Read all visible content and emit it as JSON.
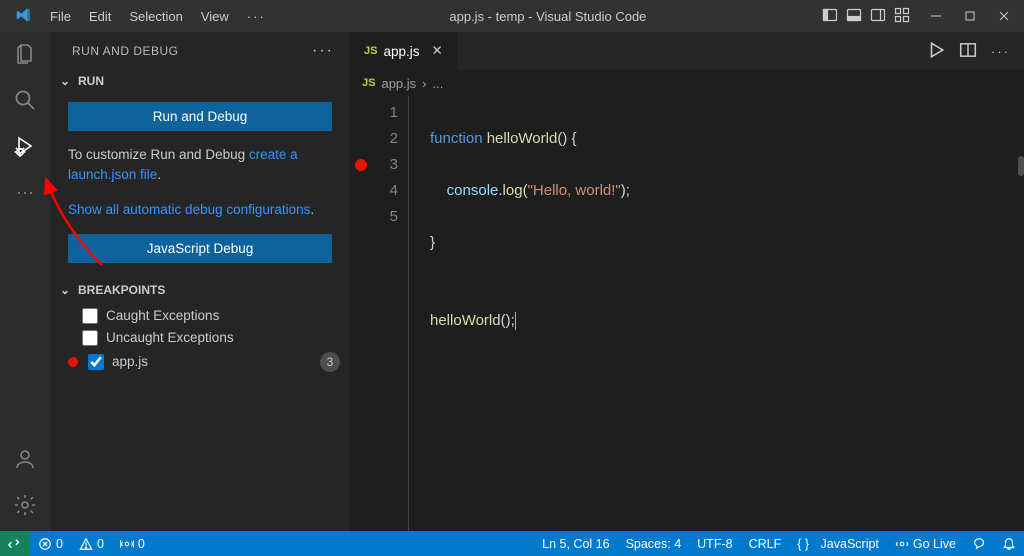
{
  "titlebar": {
    "menus": [
      "File",
      "Edit",
      "Selection",
      "View"
    ],
    "overflow": "···",
    "title": "app.js - temp - Visual Studio Code"
  },
  "sidebar": {
    "header": "RUN AND DEBUG",
    "sections": {
      "run": {
        "label": "RUN",
        "button_primary": "Run and Debug",
        "customize_prefix": "To customize Run and Debug ",
        "customize_link": "create a launch.json file",
        "customize_suffix": ".",
        "showall_link": "Show all automatic debug configurations",
        "showall_suffix": ".",
        "button_secondary": "JavaScript Debug"
      },
      "breakpoints": {
        "label": "BREAKPOINTS",
        "items": [
          {
            "label": "Caught Exceptions",
            "checked": false
          },
          {
            "label": "Uncaught Exceptions",
            "checked": false
          }
        ],
        "file": {
          "label": "app.js",
          "checked": true,
          "count": "3"
        }
      }
    }
  },
  "editor": {
    "tab": {
      "icon": "JS",
      "label": "app.js"
    },
    "breadcrumb": {
      "icon": "JS",
      "file": "app.js",
      "sep": "›",
      "rest": "..."
    },
    "code": {
      "lines": [
        "1",
        "2",
        "3",
        "4",
        "5"
      ],
      "breakpoint_line": 3,
      "l1_kw": "function",
      "l1_fn": "helloWorld",
      "l1_rest": "() {",
      "l2_obj": "console",
      "l2_dot": ".",
      "l2_fn": "log",
      "l2_open": "(",
      "l2_str": "\"Hello, world!\"",
      "l2_close": ");",
      "l3": "}",
      "l4": "",
      "l5_fn": "helloWorld",
      "l5_rest": "();"
    }
  },
  "statusbar": {
    "errors": "0",
    "warnings": "0",
    "ports": "0",
    "cursor": "Ln 5, Col 16",
    "spaces": "Spaces: 4",
    "encoding": "UTF-8",
    "eol": "CRLF",
    "language": "JavaScript",
    "golive": "Go Live"
  },
  "icons": {
    "activity": [
      "explorer",
      "search",
      "debug",
      "ellipsis"
    ],
    "activity_bottom": [
      "accounts",
      "settings"
    ]
  }
}
